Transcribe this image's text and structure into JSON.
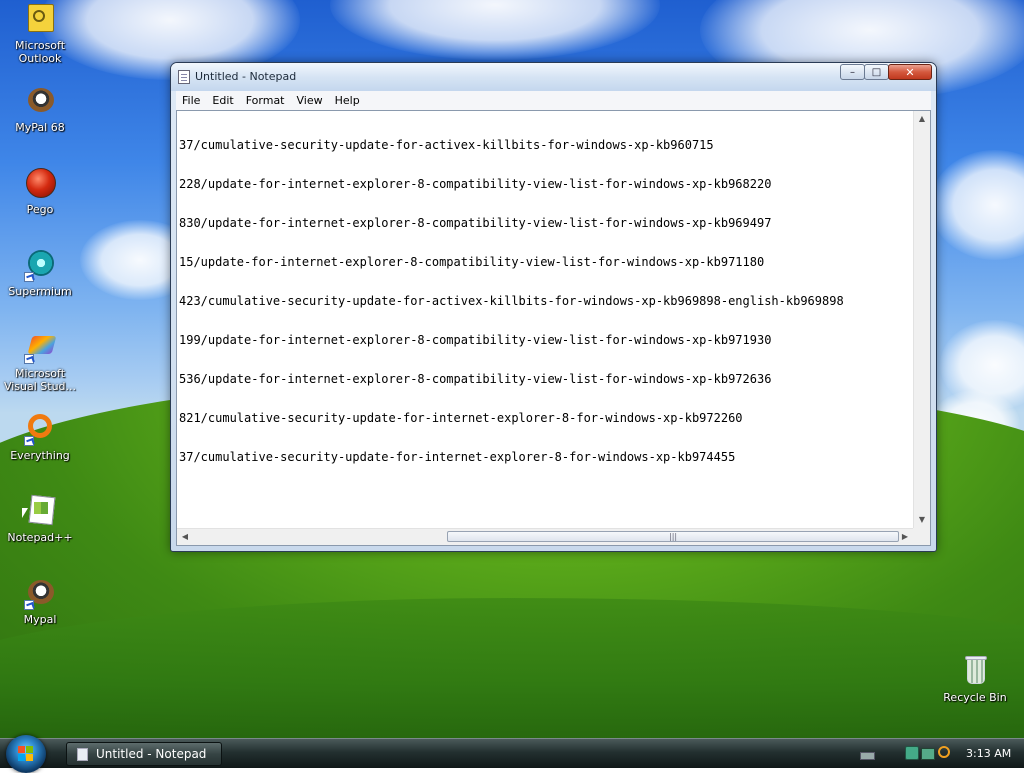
{
  "desktop": {
    "icons": [
      {
        "label": "Microsoft\nOutlook",
        "icon": "outlook-icon"
      },
      {
        "label": "MyPal 68",
        "icon": "mypal-icon"
      },
      {
        "label": "Pego",
        "icon": "pego-icon"
      },
      {
        "label": "Supermium",
        "icon": "supermium-icon"
      },
      {
        "label": "Microsoft\nVisual Stud...",
        "icon": "visual-studio-icon"
      },
      {
        "label": "Everything",
        "icon": "everything-icon"
      },
      {
        "label": "Notepad++",
        "icon": "notepadpp-icon"
      },
      {
        "label": "Mypal",
        "icon": "mypal-icon"
      }
    ],
    "recycle_bin": {
      "label": "Recycle Bin",
      "icon": "recycle-bin-icon"
    }
  },
  "notepad": {
    "title": "Untitled - Notepad",
    "menu": [
      "File",
      "Edit",
      "Format",
      "View",
      "Help"
    ],
    "lines": [
      "37/cumulative-security-update-for-activex-killbits-for-windows-xp-kb960715",
      "228/update-for-internet-explorer-8-compatibility-view-list-for-windows-xp-kb968220",
      "830/update-for-internet-explorer-8-compatibility-view-list-for-windows-xp-kb969497",
      "15/update-for-internet-explorer-8-compatibility-view-list-for-windows-xp-kb971180",
      "423/cumulative-security-update-for-activex-killbits-for-windows-xp-kb969898-english-kb969898",
      "199/update-for-internet-explorer-8-compatibility-view-list-for-windows-xp-kb971930",
      "536/update-for-internet-explorer-8-compatibility-view-list-for-windows-xp-kb972636",
      "821/cumulative-security-update-for-internet-explorer-8-for-windows-xp-kb972260",
      "37/cumulative-security-update-for-internet-explorer-8-for-windows-xp-kb974455"
    ],
    "buttons": {
      "minimize": "–",
      "maximize": "□",
      "close": "✕"
    },
    "hscroll_grip": "|||"
  },
  "taskbar": {
    "task_label": "Untitled - Notepad",
    "clock": "3:13 AM"
  },
  "colors": {
    "window_frame": "#c9d9ec",
    "close_button": "#d4593e",
    "taskbar": "#233030"
  }
}
